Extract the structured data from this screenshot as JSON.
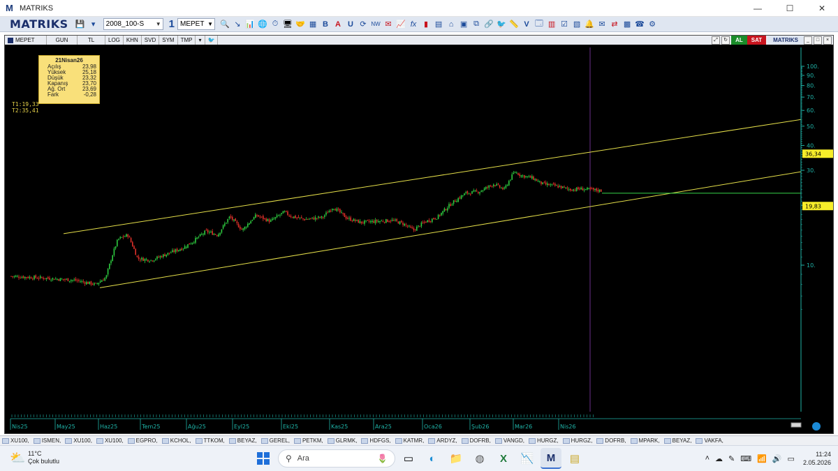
{
  "window": {
    "title": "MATRIKS",
    "logo": "M",
    "controls": [
      "—",
      "☐",
      "✕"
    ]
  },
  "toolbar": {
    "brand": "MATRIKS",
    "symbol_select": "2008_100-S",
    "period": "1",
    "ticker": "MEPET"
  },
  "chart_toolbar": {
    "symbol": "MEPET",
    "tabs": [
      "GUN",
      "TL",
      "LOG",
      "KHN",
      "SVD",
      "SYM",
      "TMP"
    ],
    "al": "AL",
    "sat": "SAT",
    "brand": "MATRIKS"
  },
  "ohlc": {
    "date": "21Nisan26",
    "rows": [
      {
        "k": "Açılış",
        "v": "23,98"
      },
      {
        "k": "Yüksek",
        "v": "25,18"
      },
      {
        "k": "Düşük",
        "v": "23,32"
      },
      {
        "k": "Kapanış",
        "v": "23,70"
      },
      {
        "k": "Ağ. Ort",
        "v": "23,69"
      },
      {
        "k": "Fark",
        "v": "-0,28"
      }
    ]
  },
  "trendlines": {
    "t1": "T1:19,33",
    "t2": "T2:35,41"
  },
  "price_tags": {
    "upper": "36,34",
    "lower": "19,83"
  },
  "chart_data": {
    "type": "candlestick",
    "symbol": "MEPET",
    "y_scale": "log",
    "y_ticks": [
      "100",
      "90",
      "80",
      "70",
      "60",
      "50",
      "40",
      "30",
      "20",
      "10"
    ],
    "x_ticks": [
      "Nis25",
      "May25",
      "Haz25",
      "Tem25",
      "Ağu25",
      "Eyl25",
      "Eki25",
      "Kas25",
      "Ara25",
      "Oca26",
      "Şub26",
      "Mar26",
      "Nis26"
    ],
    "series_close_approx": [
      {
        "x": "Nis25",
        "y": 8.8
      },
      {
        "x": "May25",
        "y": 8.3
      },
      {
        "x": "Haz25",
        "y": 8.6
      },
      {
        "x": "Haz25b",
        "y": 13.5
      },
      {
        "x": "Tem25",
        "y": 10.5
      },
      {
        "x": "Ağu25",
        "y": 12.5
      },
      {
        "x": "Eyl25",
        "y": 16.5
      },
      {
        "x": "Eki25",
        "y": 18.5
      },
      {
        "x": "Kas25",
        "y": 19.5
      },
      {
        "x": "Ara25",
        "y": 16.2
      },
      {
        "x": "Oca26",
        "y": 18.5
      },
      {
        "x": "Şub26",
        "y": 25.5
      },
      {
        "x": "Mar26",
        "y": 28.5
      },
      {
        "x": "Nis26",
        "y": 23.7
      }
    ],
    "channel": {
      "upper_label": "36,34",
      "lower_label": "19,83"
    },
    "horizontal_level": 23.0,
    "colors": {
      "up": "#2ecc40",
      "down": "#e0302a",
      "channel": "#e6e04a",
      "level": "#37d64a",
      "axis": "#1fb3a8"
    }
  },
  "symbol_tabs": [
    "XU100",
    "ISMEN",
    "XU100",
    "XU100",
    "EGPRO",
    "KCHOL",
    "TTKOM",
    "BEYAZ",
    "GEREL",
    "PETKM",
    "GLRMK",
    "HDFGS",
    "KATMR",
    "ARDYZ",
    "DOFRB",
    "VANGD",
    "HURGZ",
    "HURGZ",
    "DOFRB",
    "MPARK",
    "BEYAZ",
    "VAKFA"
  ],
  "taskbar": {
    "temp": "11°C",
    "weather": "Çok bulutlu",
    "search_placeholder": "Ara",
    "time": "11:24",
    "date": "2.05.2026"
  }
}
